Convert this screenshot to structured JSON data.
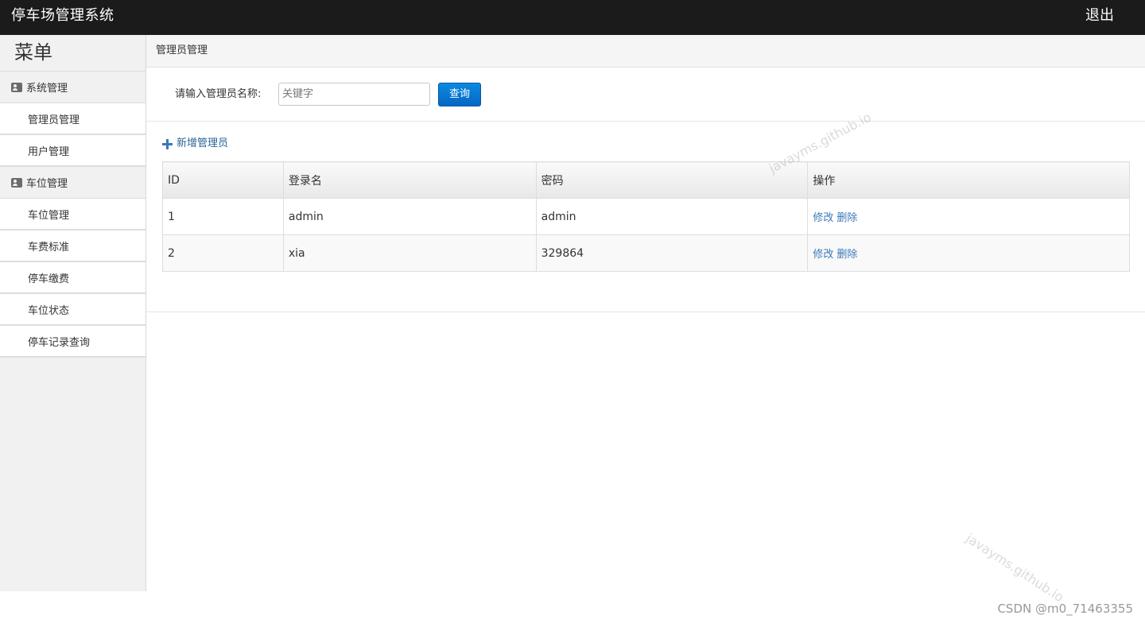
{
  "header": {
    "title": "停车场管理系统",
    "logout_label": "退出"
  },
  "sidebar": {
    "menu_title": "菜单",
    "groups": [
      {
        "label": "系统管理",
        "items": [
          "管理员管理",
          "用户管理"
        ]
      },
      {
        "label": "车位管理",
        "items": [
          "车位管理",
          "车费标准",
          "停车缴费",
          "车位状态",
          "停车记录查询"
        ]
      }
    ]
  },
  "main": {
    "breadcrumb": "管理员管理",
    "search": {
      "label": "请输入管理员名称:",
      "placeholder": "关键字",
      "value": "",
      "button_label": "查询"
    },
    "add_label": "新增管理员",
    "table": {
      "columns": [
        "ID",
        "登录名",
        "密码",
        "操作"
      ],
      "rows": [
        {
          "id": "1",
          "login": "admin",
          "password": "admin",
          "actions": [
            "修改",
            "删除"
          ]
        },
        {
          "id": "2",
          "login": "xia",
          "password": "329864",
          "actions": [
            "修改",
            "删除"
          ]
        }
      ]
    }
  },
  "watermarks": {
    "site": "javayms.github.io",
    "csdn": "CSDN @m0_71463355"
  },
  "colors": {
    "topbar": "#1b1b1b",
    "primary_button": "#0567c4",
    "link": "#3a7ab8"
  }
}
